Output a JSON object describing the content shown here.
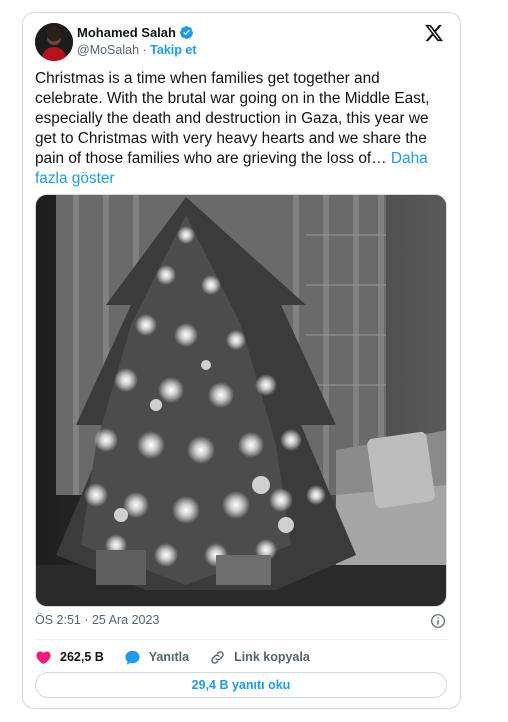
{
  "author": {
    "name": "Mohamed Salah",
    "handle": "@MoSalah",
    "separator": "·",
    "follow_label": "Takip et"
  },
  "tweet": {
    "text": "Christmas is a time when families get together and celebrate. With the brutal war going on in the Middle East, especially the death and destruction in Gaza, this year we get to Christmas with very heavy hearts and we share the pain of those families who are grieving the loss of…",
    "show_more": "Daha fazla göster"
  },
  "meta": {
    "timestamp": "ÖS 2:51 · 25 Ara 2023"
  },
  "actions": {
    "likes": "262,5 B",
    "reply_label": "Yanıtla",
    "copy_link_label": "Link kopyala",
    "read_replies": "29,4 B yanıtı oku"
  },
  "colors": {
    "accent": "#1d9bf0",
    "like": "#f91880",
    "muted": "#536471",
    "border": "#cfd9de"
  },
  "icons": [
    "verified-badge-icon",
    "x-logo-icon",
    "info-icon",
    "heart-icon",
    "reply-bubble-icon",
    "link-icon"
  ]
}
